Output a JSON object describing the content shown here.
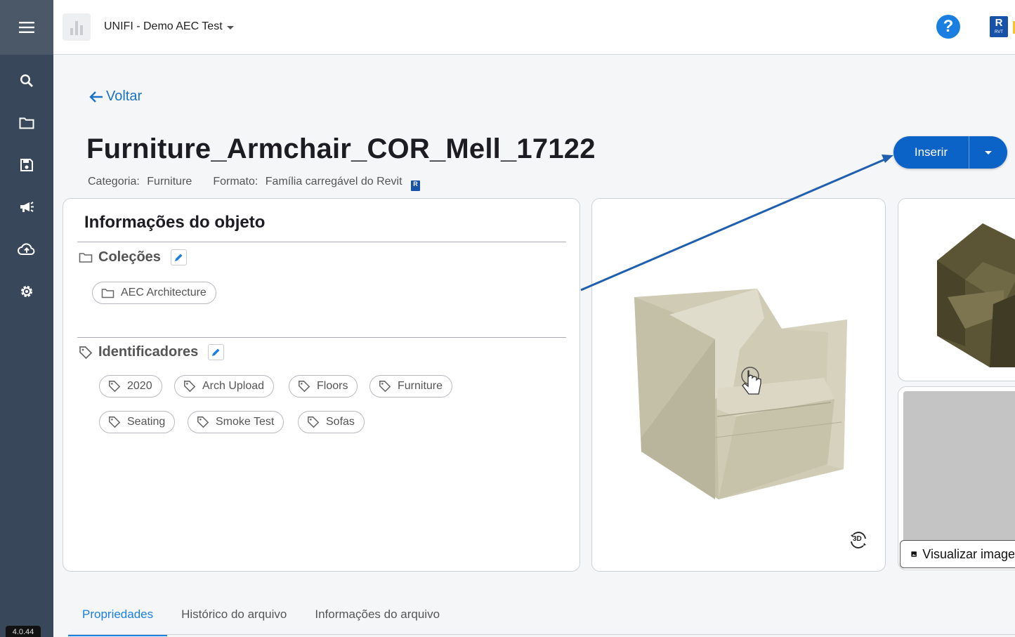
{
  "workspace": {
    "name": "UNIFI - Demo AEC Test"
  },
  "header": {
    "help_label": "?",
    "revit_badge": "R",
    "revit_badge_sub": "RVT"
  },
  "sidebar": {
    "items": [
      {
        "name": "search-icon"
      },
      {
        "name": "folder-icon"
      },
      {
        "name": "save-icon"
      },
      {
        "name": "megaphone-icon"
      },
      {
        "name": "cloud-upload-icon"
      },
      {
        "name": "gear-icon"
      }
    ],
    "version": "4.0.44"
  },
  "main": {
    "back_label": "Voltar",
    "title": "Furniture_Armchair_COR_Mell_17122",
    "category_label": "Categoria:",
    "category_value": "Furniture",
    "format_label": "Formato:",
    "format_value": "Família carregável do Revit",
    "insert_label": "Inserir"
  },
  "info": {
    "title": "Informações do objeto",
    "collections_label": "Coleções",
    "collections": [
      "AEC Architecture"
    ],
    "tags_label": "Identificadores",
    "tags": [
      "2020",
      "Arch Upload",
      "Floors",
      "Furniture",
      "Seating",
      "Smoke Test",
      "Sofas"
    ]
  },
  "preview": {
    "badge_3d": "3D",
    "view_image_label": "Visualizar imagem"
  },
  "tabs": [
    "Propriedades",
    "Histórico do arquivo",
    "Informações do arquivo"
  ],
  "colors": {
    "accent": "#1a7fe0",
    "primary_button": "#0b63c8",
    "sidebar": "#38475a"
  }
}
